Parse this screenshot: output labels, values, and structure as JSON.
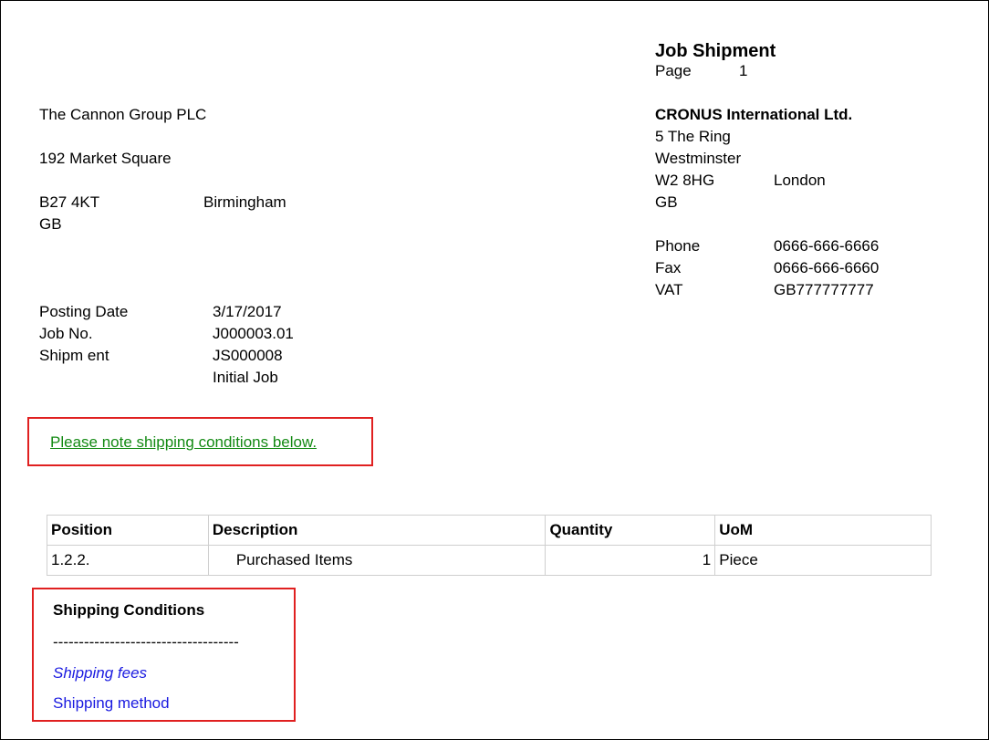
{
  "report": {
    "title": "Job Shipment",
    "page_label": "Page",
    "page_number": "1"
  },
  "customer": {
    "name": "The Cannon Group PLC",
    "address": "192 Market Square",
    "postcode": "B27 4KT",
    "city": "Birmingham",
    "country": "GB"
  },
  "company": {
    "name": "CRONUS International Ltd.",
    "address1": "5 The Ring",
    "address2": "Westminster",
    "postcode": "W2 8HG",
    "city": "London",
    "country": "GB",
    "phone_label": "Phone",
    "phone": "0666-666-6666",
    "fax_label": "Fax",
    "fax": "0666-666-6660",
    "vat_label": "VAT",
    "vat": "GB777777777"
  },
  "details": {
    "posting_date_label": "Posting Date",
    "posting_date": "3/17/2017",
    "job_no_label": "Job No.",
    "job_no": "J000003.01",
    "shipment_label": "Shipm ent",
    "shipment_no": "JS000008",
    "job_description": "Initial Job"
  },
  "notice": {
    "text": "Please note shipping conditions below."
  },
  "lines": {
    "headers": [
      "Position",
      "Description",
      "Quantity",
      "UoM"
    ],
    "rows": [
      {
        "position": "1.2.2.",
        "description": "Purchased Items",
        "quantity": "1",
        "uom": "Piece"
      }
    ]
  },
  "shipping_conditions": {
    "title": "Shipping Conditions",
    "separator": "------------------------------------",
    "fees": "Shipping fees",
    "method": "Shipping method"
  },
  "colors": {
    "border_red": "#e02020",
    "notice_green": "#138a13",
    "link_blue": "#1a1ae0"
  }
}
